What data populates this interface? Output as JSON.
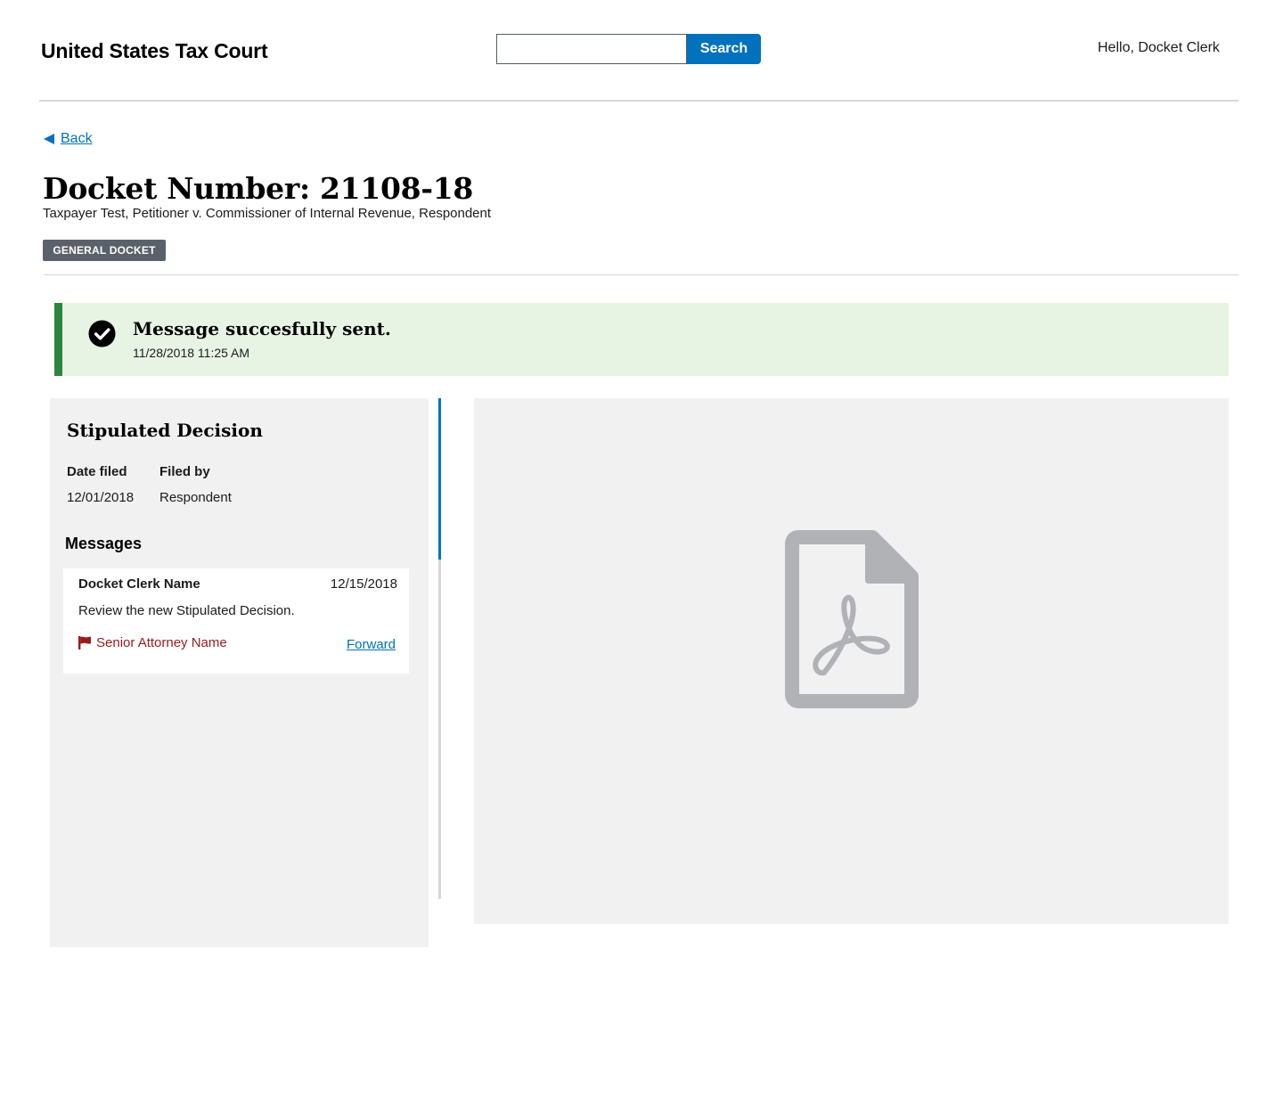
{
  "header": {
    "site_title": "United States Tax Court",
    "search": {
      "value": "",
      "placeholder": "",
      "button_label": "Search"
    },
    "greeting": "Hello, Docket Clerk"
  },
  "nav": {
    "back_label": "Back"
  },
  "case": {
    "docket_title": "Docket Number: 21108-18",
    "caption": "Taxpayer Test, Petitioner v. Commissioner of Internal Revenue, Respondent",
    "badge": "GENERAL DOCKET"
  },
  "alert": {
    "heading": "Message succesfully sent.",
    "timestamp": "11/28/2018 11:25 AM",
    "status_color": "#2e8540"
  },
  "document": {
    "title": "Stipulated Decision",
    "date_filed_label": "Date filed",
    "date_filed": "12/01/2018",
    "filed_by_label": "Filed by",
    "filed_by": "Respondent"
  },
  "messages": {
    "heading": "Messages",
    "items": [
      {
        "sender": "Docket Clerk Name",
        "date": "12/15/2018",
        "body": "Review the new Stipulated Decision.",
        "flag_recipient": "Senior Attorney Name",
        "forward_label": "Forward"
      }
    ]
  },
  "viewer": {
    "icon": "pdf-file-icon"
  },
  "colors": {
    "primary": "#0071bc",
    "success": "#2e8540",
    "flag": "#981b1e",
    "panel_bg": "#f1f1f1",
    "badge_bg": "#5b616b"
  }
}
